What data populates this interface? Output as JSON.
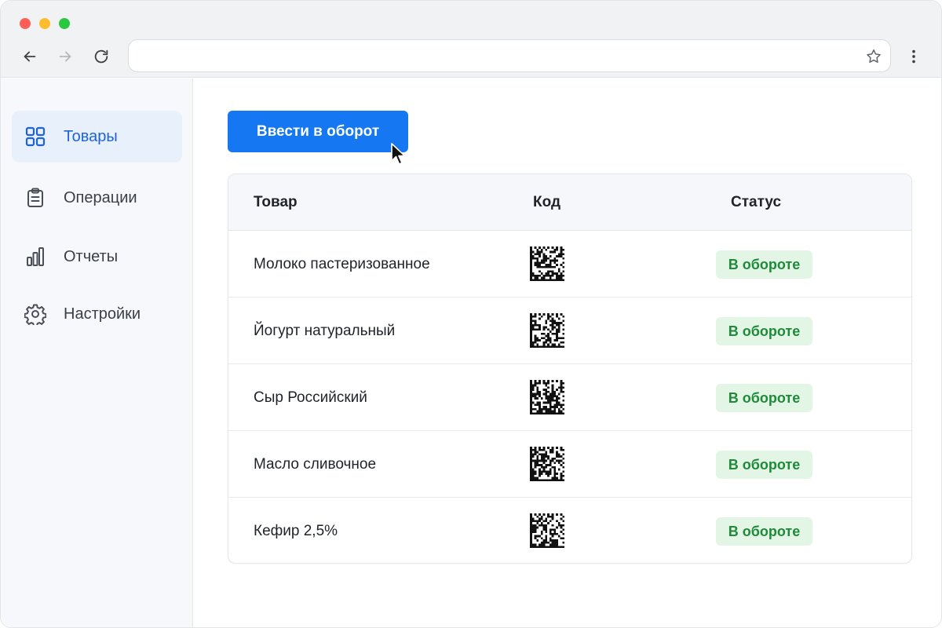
{
  "browser": {
    "address_value": "",
    "icons": [
      "back-icon",
      "forward-icon",
      "reload-icon",
      "star-icon",
      "kebab-menu-icon"
    ]
  },
  "sidebar": {
    "items": [
      {
        "label": "Товары",
        "icon": "grid-icon",
        "active": true
      },
      {
        "label": "Операции",
        "icon": "clipboard-icon",
        "active": false
      },
      {
        "label": "Отчеты",
        "icon": "bar-chart-icon",
        "active": false
      },
      {
        "label": "Настройки",
        "icon": "gear-icon",
        "active": false
      }
    ]
  },
  "main": {
    "primary_button": "Ввести в оборот",
    "table": {
      "headers": [
        "Товар",
        "Код",
        "Статус"
      ],
      "rows": [
        {
          "name": "Молоко пастеризованное",
          "status": "В обороте"
        },
        {
          "name": "Йогурт натуральный",
          "status": "В обороте"
        },
        {
          "name": "Сыр Российский",
          "status": "В обороте"
        },
        {
          "name": "Масло сливочное",
          "status": "В обороте"
        },
        {
          "name": "Кефир 2,5%",
          "status": "В обороте"
        }
      ]
    }
  },
  "colors": {
    "accent": "#1677f2",
    "active_nav_bg": "#e8f0fc",
    "active_nav_text": "#1f63d6",
    "status_bg": "#e3f5e5",
    "status_text": "#1f8a3a"
  }
}
